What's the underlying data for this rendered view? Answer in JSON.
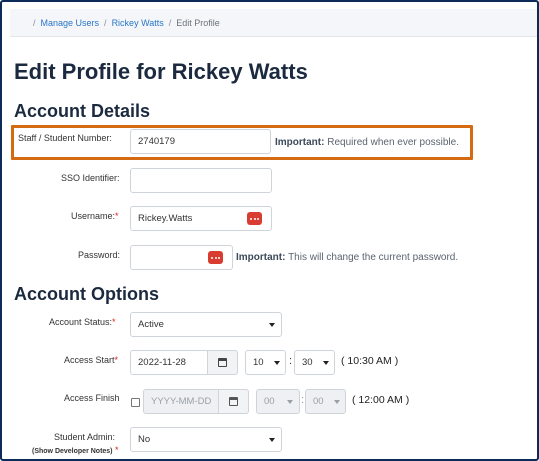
{
  "breadcrumb": {
    "items": [
      "Manage Users",
      "Rickey Watts"
    ],
    "current": "Edit Profile"
  },
  "page_title": "Edit Profile for Rickey Watts",
  "account_details": {
    "title": "Account Details",
    "staff_number": {
      "label": "Staff / Student Number:",
      "value": "2740179",
      "note_strong": "Important:",
      "note_text": "Required when ever possible."
    },
    "sso": {
      "label": "SSO Identifier:",
      "value": ""
    },
    "username": {
      "label": "Username:",
      "required_mark": "*",
      "value": "Rickey.Watts"
    },
    "password": {
      "label": "Password:",
      "value": "",
      "note_strong": "Important:",
      "note_text": "This will change the current password."
    }
  },
  "account_options": {
    "title": "Account Options",
    "status": {
      "label": "Account Status:",
      "required_mark": "*",
      "value": "Active"
    },
    "access_start": {
      "label": "Access Start",
      "required_mark": "*",
      "date": "2022-11-28",
      "hour": "10",
      "minute": "30",
      "display": "( 10:30 AM )"
    },
    "access_finish": {
      "label": "Access Finish",
      "date_placeholder": "YYYY-MM-DD",
      "hour": "00",
      "minute": "00",
      "display": "( 12:00 AM )"
    },
    "student_admin": {
      "label": "Student Admin:",
      "dev_notes": "(Show Developer Notes)",
      "required_mark": "*",
      "value": "No"
    }
  },
  "icons": {
    "generate": "dots-icon",
    "calendar": "calendar-icon",
    "dropdown": "chevron-down-icon"
  },
  "colors": {
    "frame_border": "#0d2b59",
    "highlight": "#d46a12",
    "action_red": "#d93d32",
    "link": "#2a76c6"
  }
}
